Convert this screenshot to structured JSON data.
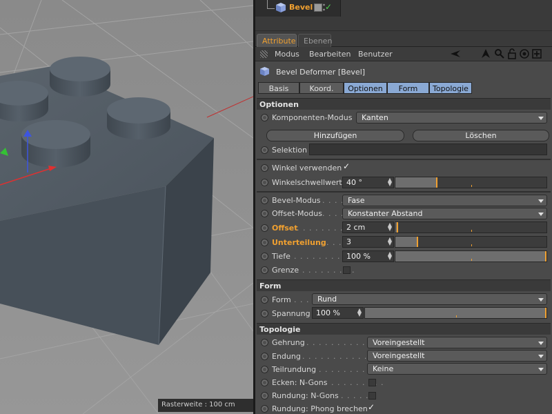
{
  "viewport": {
    "status_text": "Rasterweite : 100 cm"
  },
  "object_manager": {
    "object_name": "Bevel"
  },
  "tabs": [
    "Attribute",
    "Ebenen"
  ],
  "menu": [
    "Modus",
    "Bearbeiten",
    "Benutzer"
  ],
  "object_title": "Bevel Deformer [Bevel]",
  "subtabs": [
    "Basis",
    "Koord.",
    "Optionen",
    "Form",
    "Topologie"
  ],
  "sections": {
    "optionen": "Optionen",
    "form": "Form",
    "topologie": "Topologie"
  },
  "optionen": {
    "komponenten_modus": {
      "label": "Komponenten-Modus",
      "value": "Kanten"
    },
    "hinzufuegen_label": "Hinzufügen",
    "loeschen_label": "Löschen",
    "selektion_label": "Selektion",
    "winkel_verwenden": {
      "label": "Winkel verwenden",
      "checked": true
    },
    "winkelschwellwert": {
      "label": "Winkelschwellwert",
      "value": "40 °",
      "fraction": 0.28
    },
    "bevel_modus": {
      "label": "Bevel-Modus",
      "dots": ". . . .",
      "value": "Fase"
    },
    "offset_modus": {
      "label": "Offset-Modus",
      "dots": ". . . .",
      "value": "Konstanter Abstand"
    },
    "offset": {
      "label": "Offset",
      "dots": ". . . . . . . . .",
      "value": "2 cm",
      "fraction": 0.02
    },
    "unterteilung": {
      "label": "Unterteilung",
      "dots": ". . . . .",
      "value": "3",
      "fraction": 0.15
    },
    "tiefe": {
      "label": "Tiefe",
      "dots": ". . . . . . . . . . .",
      "value": "100 %",
      "fraction": 1.0
    },
    "grenze": {
      "label": "Grenze",
      "dots": ". . . . . . . . .",
      "checked": false
    }
  },
  "form": {
    "form": {
      "label": "Form",
      "dots": ". . . .",
      "value": "Rund"
    },
    "spannung": {
      "label": "Spannung",
      "value": "100 %",
      "fraction": 1.0
    }
  },
  "topologie": {
    "gehrung": {
      "label": "Gehrung",
      "dots": ". . . . . . . . . . . . . . .",
      "value": "Voreingestellt"
    },
    "endung": {
      "label": "Endung",
      "dots": ". . . . . . . . . . . . . . . .",
      "value": "Voreingestellt"
    },
    "teilrundung": {
      "label": "Teilrundung",
      "dots": ". . . . . . . . . . . . .",
      "value": "Keine"
    },
    "ecken_ngons": {
      "label": "Ecken: N-Gons",
      "dots": ". . . . . . . . .",
      "checked": false
    },
    "rundung_ngons": {
      "label": "Rundung: N-Gons",
      "dots": ". . . . . .",
      "checked": false
    },
    "rundung_phong": {
      "label": "Rundung: Phong brechen",
      "checked": true
    }
  },
  "colors": {
    "accent_orange": "#f0a030",
    "active_tab_blue": "#8aa9d4",
    "panel_bg": "#4a4a4a",
    "viewport_bg": "#8e8e8e",
    "model_color": "#4d5660"
  }
}
